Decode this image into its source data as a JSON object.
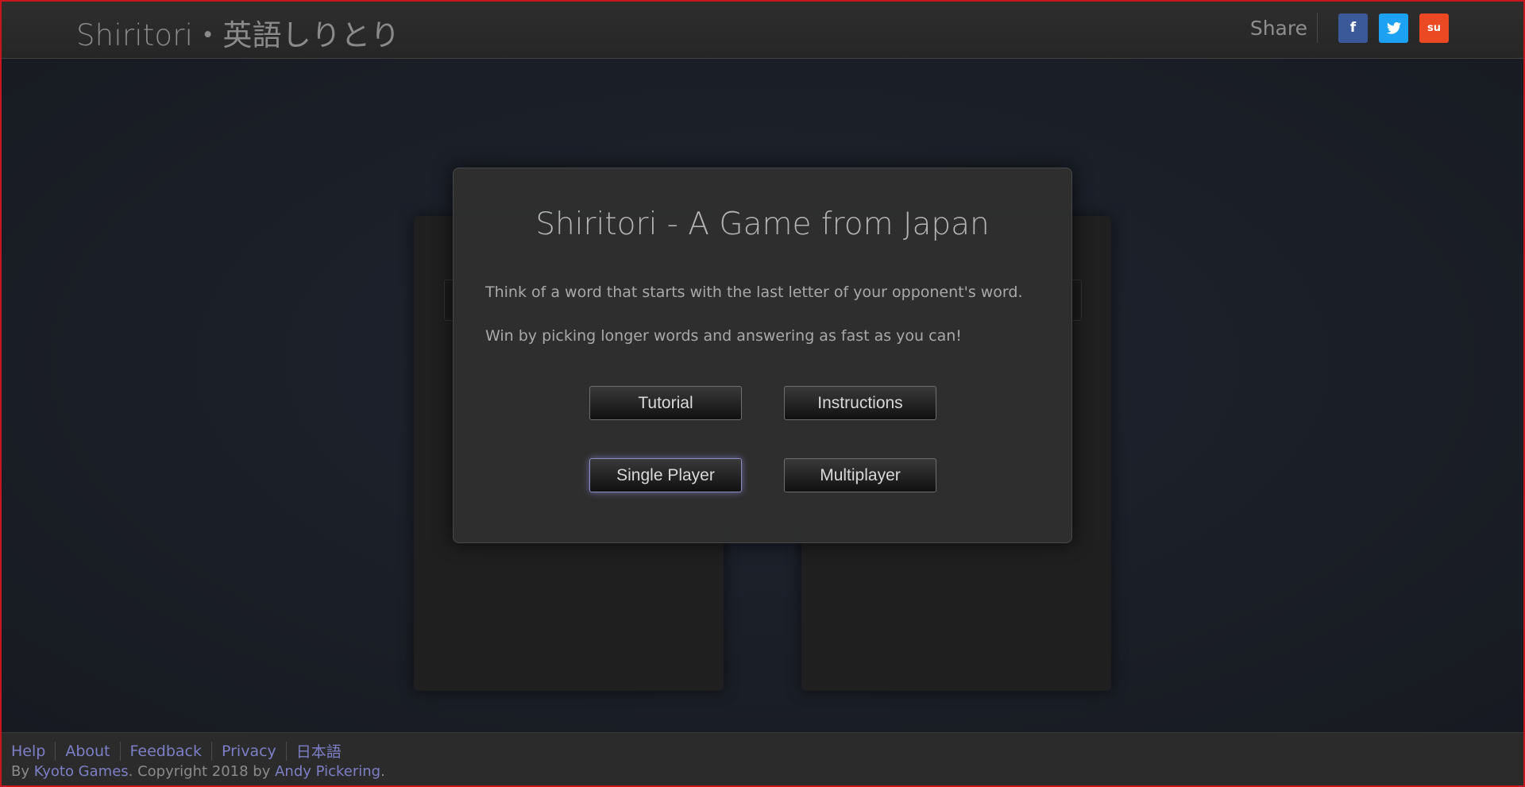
{
  "header": {
    "title": "Shiritori・英語しりとり",
    "share_label": "Share",
    "share_buttons": [
      {
        "name": "facebook",
        "glyph": "f",
        "color": "#3b5998"
      },
      {
        "name": "twitter",
        "glyph": "t",
        "color": "#1da1f2"
      },
      {
        "name": "stumbleupon",
        "glyph": "su",
        "color": "#eb4924"
      }
    ]
  },
  "modal": {
    "title": "Shiritori - A Game from Japan",
    "line1": "Think of a word that starts with the last letter of your opponent's word.",
    "line2": "Win by picking longer words and answering as fast as you can!",
    "buttons": {
      "tutorial": "Tutorial",
      "instructions": "Instructions",
      "single_player": "Single Player",
      "multiplayer": "Multiplayer"
    }
  },
  "footer": {
    "links": [
      "Help",
      "About",
      "Feedback",
      "Privacy",
      "日本語"
    ],
    "copyright": {
      "prefix": "By ",
      "company": "Kyoto Games",
      "middle": ". Copyright 2018 by ",
      "author": "Andy Pickering",
      "suffix": "."
    }
  }
}
